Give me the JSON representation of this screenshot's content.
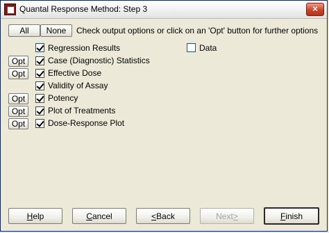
{
  "window": {
    "title": "Quantal Response Method: Step 3",
    "close_symbol": "×"
  },
  "toolbar": {
    "all_label": "All",
    "none_label": "None",
    "instruction": "Check output options or click on an 'Opt' button for further options"
  },
  "opt_label": "Opt",
  "options": [
    {
      "label": "Regression Results",
      "checked": true,
      "has_opt": false
    },
    {
      "label": "Case (Diagnostic) Statistics",
      "checked": true,
      "has_opt": true
    },
    {
      "label": "Effective Dose",
      "checked": true,
      "has_opt": true
    },
    {
      "label": "Validity of Assay",
      "checked": true,
      "has_opt": false
    },
    {
      "label": "Potency",
      "checked": true,
      "has_opt": true
    },
    {
      "label": "Plot of Treatments",
      "checked": true,
      "has_opt": true
    },
    {
      "label": "Dose-Response Plot",
      "checked": true,
      "has_opt": true
    }
  ],
  "data_option": {
    "label": "Data",
    "checked": false
  },
  "footer": {
    "help_prefix": "",
    "help_u": "H",
    "help_rest": "elp",
    "cancel_prefix": "",
    "cancel_u": "C",
    "cancel_rest": "ancel",
    "back_prefix": "",
    "back_u": "<",
    "back_rest": " Back",
    "next_prefix": "Next ",
    "next_u": ">",
    "next_rest": "",
    "finish_prefix": "",
    "finish_u": "F",
    "finish_rest": "inish"
  }
}
